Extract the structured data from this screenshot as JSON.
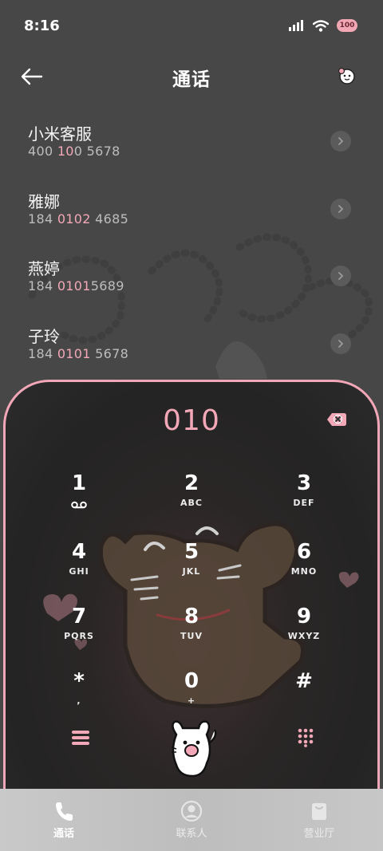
{
  "status": {
    "time": "8:16",
    "battery": "100"
  },
  "header": {
    "title": "通话"
  },
  "calls": [
    {
      "name": "小米客服",
      "num_pre": "400 ",
      "num_hl": "10",
      "num_post": "0 5678"
    },
    {
      "name": "雅娜",
      "num_pre": "184 ",
      "num_hl": "0102",
      "num_post": " 4685"
    },
    {
      "name": "燕婷",
      "num_pre": "184 ",
      "num_hl": "0101",
      "num_post": "5689"
    },
    {
      "name": "子玲",
      "num_pre": "184 ",
      "num_hl": "0101",
      "num_post": " 5678"
    }
  ],
  "dialer": {
    "input": "010"
  },
  "keys": [
    {
      "digit": "1",
      "letters": ""
    },
    {
      "digit": "2",
      "letters": "ABC"
    },
    {
      "digit": "3",
      "letters": "DEF"
    },
    {
      "digit": "4",
      "letters": "GHI"
    },
    {
      "digit": "5",
      "letters": "JKL"
    },
    {
      "digit": "6",
      "letters": "MNO"
    },
    {
      "digit": "7",
      "letters": "PQRS"
    },
    {
      "digit": "8",
      "letters": "TUV"
    },
    {
      "digit": "9",
      "letters": "WXYZ"
    },
    {
      "digit": "*",
      "letters": ","
    },
    {
      "digit": "0",
      "letters": "+"
    },
    {
      "digit": "#",
      "letters": ""
    }
  ],
  "nav": [
    {
      "label": "通话",
      "active": true
    },
    {
      "label": "联系人",
      "active": false
    },
    {
      "label": "营业厅",
      "active": false
    }
  ],
  "colors": {
    "accent_pink": "#f3a8b8",
    "panel_dark": "#242424",
    "page_bg": "#474747"
  }
}
